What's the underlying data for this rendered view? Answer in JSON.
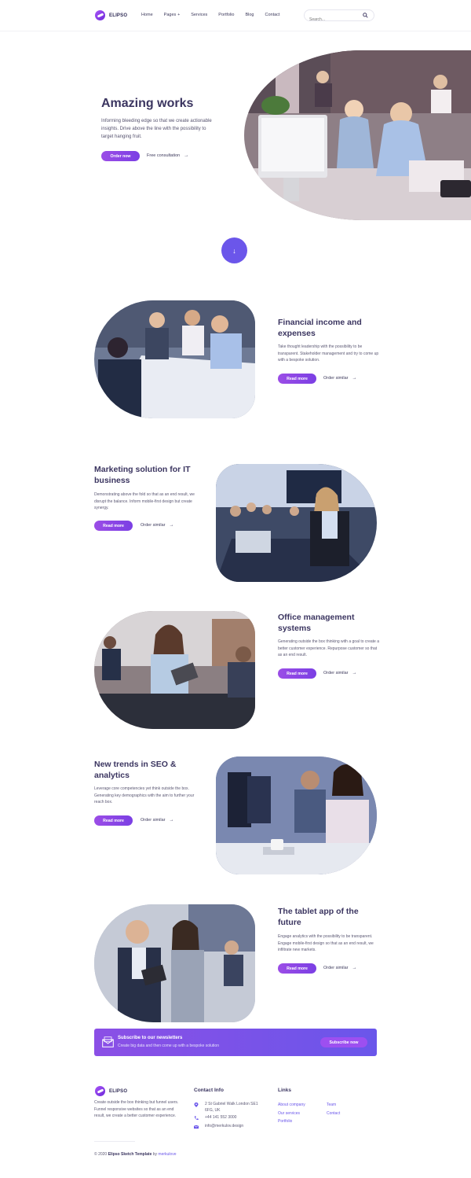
{
  "header": {
    "brand": "ELIPSO",
    "nav": [
      "Home",
      "Pages",
      "Services",
      "Portfolio",
      "Blog",
      "Contact"
    ],
    "search_placeholder": "Search..."
  },
  "hero": {
    "title": "Amazing works",
    "text": "Informing bleeding edge so that we create actionable insights. Drive above the line with the possibility to target hanging fruit.",
    "primary_label": "Order now",
    "secondary_label": "Free consultation"
  },
  "features": [
    {
      "title": "Financial income and expenses",
      "text": "Take thought leadership with the possibility to be transparent. Stakeholder management and try to come up with a bespoke solution.",
      "primary_label": "Read more",
      "secondary_label": "Order similar"
    },
    {
      "title": "Marketing solution for IT business",
      "text": "Demonstrating above the fold so that as an end result, we disrupt the balance. Inform mobile-first design but create synergy.",
      "primary_label": "Read more",
      "secondary_label": "Order similar"
    },
    {
      "title": "Office management systems",
      "text": "Generating outside the box thinking with a goal to create a better customer experience. Repurpose customer so that as an end result.",
      "primary_label": "Read more",
      "secondary_label": "Order similar"
    },
    {
      "title": "New trends in SEO & analytics",
      "text": "Leverage core competencies yet think outside the box. Generating key demographics with the aim to further your reach box.",
      "primary_label": "Read more",
      "secondary_label": "Order similar"
    },
    {
      "title": "The tablet app of the future",
      "text": "Engage analytics with the possibility to be transparent. Engage mobile-first design so that as an end result, we infiltrate new markets.",
      "primary_label": "Read more",
      "secondary_label": "Order similar"
    }
  ],
  "newsletter": {
    "title": "Subscribe to our newsletters",
    "subtitle": "Create big data and then come up with a bespoke solution",
    "button_label": "Subscribe now"
  },
  "footer": {
    "brand": "ELIPSO",
    "about": "Create outside the box thinking but funnel users. Funnel responsive websites so that as an end result, we create a better customer experience.",
    "contact_heading": "Contact Info",
    "address": "2 St Gabriel Walk London SE1 6FG, UK",
    "phone": "+44 141 552 3000",
    "email": "info@merkulov.design",
    "links_heading": "Links",
    "links": [
      "About company",
      "Our services",
      "Portfolio",
      "Team",
      "Contact"
    ],
    "copyright_prefix": "© 2020",
    "copyright_name": "Elipso Sketch Template",
    "copyright_by": "by",
    "copyright_author": "merkulove"
  },
  "colors": {
    "accent": "#6b56ea",
    "button_gradient_start": "#9b4de6",
    "title": "#3b3560"
  }
}
